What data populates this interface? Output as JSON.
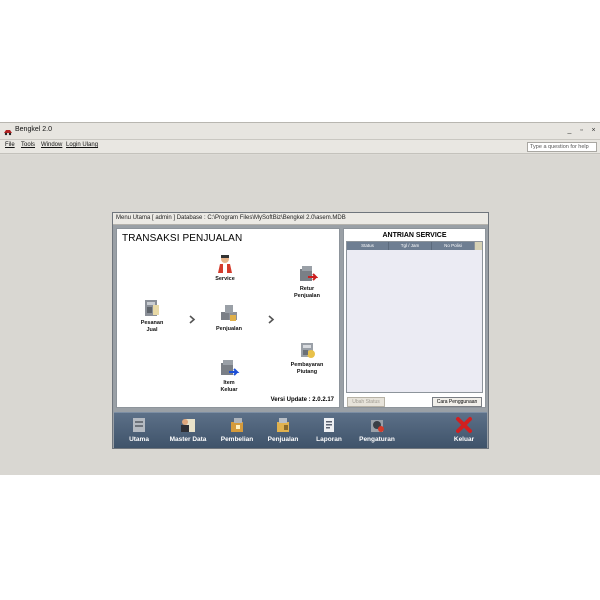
{
  "window": {
    "title": "Bengkel 2.0"
  },
  "menubar": {
    "items": [
      {
        "label": "File"
      },
      {
        "label": "Tools"
      },
      {
        "label": "Window"
      },
      {
        "label": "Login Ulang"
      }
    ],
    "help_placeholder": "Type a question for help"
  },
  "child_window": {
    "title": "Menu Utama [ admin ] Database : C:\\Program Files\\MySoftBiz\\Bengkel 2.0\\asem.MDB"
  },
  "transaksi": {
    "title": "TRANSAKSI PENJUALAN",
    "nodes": {
      "pesanan": "Pesanan\nJual",
      "service": "Service",
      "penjualan": "Penjualan",
      "item_keluar": "Item\nKeluar",
      "retur": "Retur\nPenjualan",
      "pembayaran": "Pembayaran\nPiutang"
    },
    "version": "Versi Update : 2.0.2.17"
  },
  "antrian": {
    "title": "ANTRIAN SERVICE",
    "columns": [
      "Status",
      "Tgl / Jam",
      "No Polisi"
    ],
    "rows": [],
    "ubah_button": "Ubah Status",
    "cara_button": "Cara Penggunaan"
  },
  "toolbar": {
    "items": [
      {
        "label": "Utama",
        "icon": "server-icon"
      },
      {
        "label": "Master Data",
        "icon": "person-document-icon"
      },
      {
        "label": "Pembelian",
        "icon": "box-buy-icon"
      },
      {
        "label": "Penjualan",
        "icon": "box-sell-icon"
      },
      {
        "label": "Laporan",
        "icon": "report-icon"
      },
      {
        "label": "Pengaturan",
        "icon": "settings-icon"
      },
      {
        "label": "Keluar",
        "icon": "close-icon"
      }
    ]
  },
  "colors": {
    "toolbar_bg": "#4a5e76",
    "grid_header": "#6e7e92",
    "exit_red": "#d21f1f"
  }
}
